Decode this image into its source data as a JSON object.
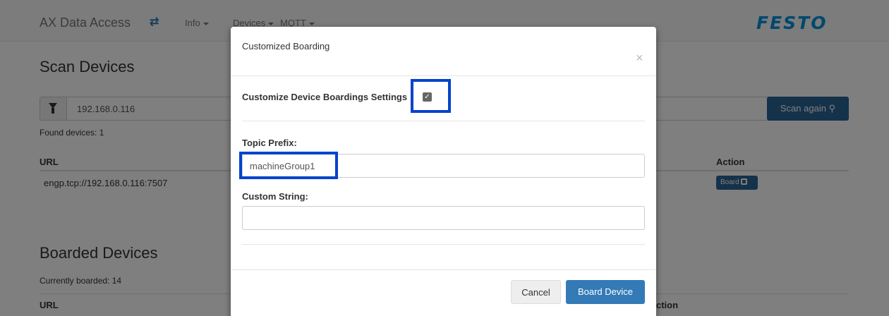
{
  "navbar": {
    "brand": "AX Data Access",
    "swap_glyph": "⇄",
    "items": [
      "Info",
      "Devices",
      "MQTT"
    ],
    "logo": "FESTO"
  },
  "scan": {
    "heading": "Scan Devices",
    "ip_value": "192.168.0.116",
    "scan_button": "Scan again",
    "found": "Found devices: 1",
    "col_url": "URL",
    "col_action": "Action",
    "rows": [
      {
        "url": "engp.tcp://192.168.0.116:7507",
        "action": "Board"
      }
    ]
  },
  "boarded": {
    "heading": "Boarded Devices",
    "count": "Currently boarded: 14",
    "col_url": "URL",
    "col_action_partial": "ction"
  },
  "modal": {
    "title": "Customized Boarding",
    "close_glyph": "×",
    "customize_label": "Customize Device Boardings Settings",
    "customize_checked": true,
    "check_glyph": "✓",
    "topic_label": "Topic Prefix:",
    "topic_value": "machineGroup1",
    "custom_label": "Custom String:",
    "custom_value": "",
    "cancel": "Cancel",
    "submit": "Board Device"
  },
  "colors": {
    "primary": "#337ab7",
    "highlight": "#0044cc",
    "logo": "#0091dc"
  }
}
